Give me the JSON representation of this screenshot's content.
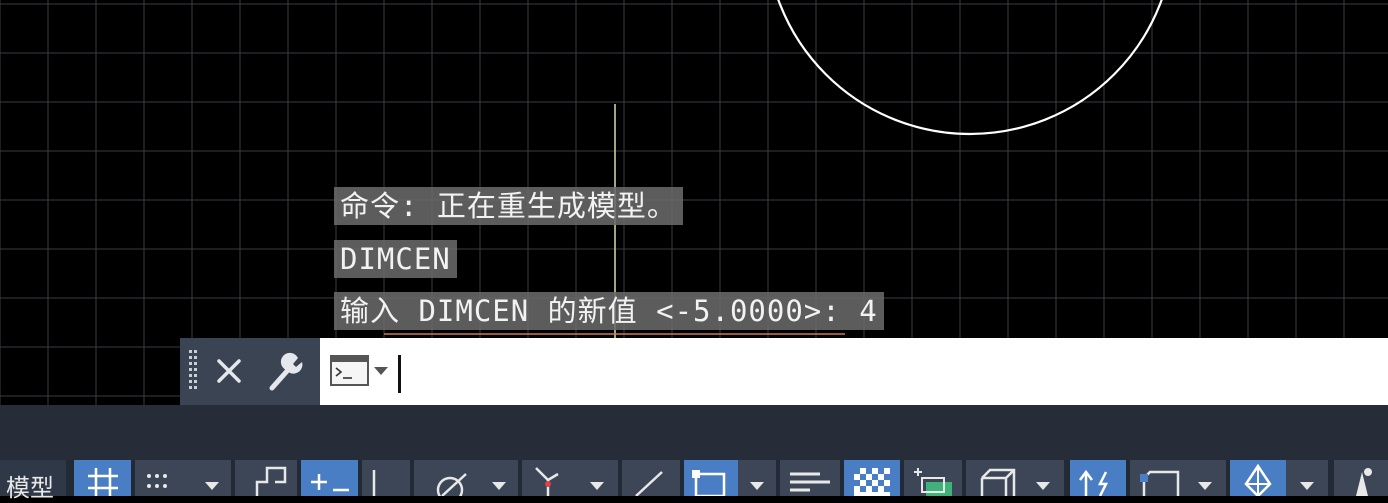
{
  "command_history": [
    "命令: 正在重生成模型。",
    "DIMCEN",
    "输入 DIMCEN 的新值 <-5.0000>: 4"
  ],
  "command_line": {
    "value": "",
    "close_icon": "close-icon",
    "customize_icon": "wrench-icon",
    "recent_commands_icon": "command-prompt-icon"
  },
  "status_bar": {
    "model_tab": "模型",
    "buttons": [
      {
        "icon": "grid-icon",
        "active": true
      },
      {
        "icon": "snap-icon",
        "active": false
      },
      {
        "icon": "ortho-icon",
        "active": false
      },
      {
        "icon": "dynamic-input-icon",
        "active": true
      },
      {
        "icon": "polar-tracking-icon",
        "active": false
      },
      {
        "icon": "isodraft-icon",
        "active": false
      },
      {
        "icon": "object-snap-tracking-icon",
        "active": false
      },
      {
        "icon": "object-snap-icon",
        "active": true
      },
      {
        "icon": "lineweight-icon",
        "active": false
      },
      {
        "icon": "transparency-icon",
        "active": true
      },
      {
        "icon": "selection-cycling-icon",
        "active": false
      },
      {
        "icon": "3d-osnap-icon",
        "active": false
      },
      {
        "icon": "dynamic-ucs-icon",
        "active": true
      },
      {
        "icon": "gizmo-icon",
        "active": false
      },
      {
        "icon": "annotation-monitor-icon",
        "active": true
      },
      {
        "icon": "annotation-scale-icon",
        "active": false
      }
    ]
  },
  "colors": {
    "background": "#000000",
    "grid": "#3a3d42",
    "circle": "#ffffff",
    "axis_y": "#c8d2a0",
    "axis_x": "#c8785a",
    "active_button": "#4a7ec4"
  }
}
